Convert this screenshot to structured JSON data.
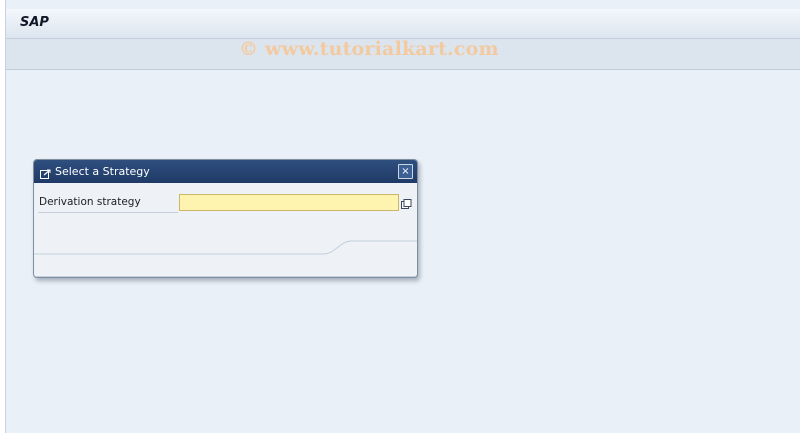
{
  "app": {
    "title": "SAP"
  },
  "watermark": {
    "text": "© www.tutorialkart.com"
  },
  "dialog": {
    "title": "Select a Strategy",
    "close_label": "×",
    "fields": [
      {
        "label": "Derivation strategy",
        "value": "",
        "placeholder": ""
      }
    ]
  },
  "colors": {
    "dialog_header": "#1f3a66",
    "input_required": "#fff3b0",
    "background": "#eaf0f7"
  }
}
